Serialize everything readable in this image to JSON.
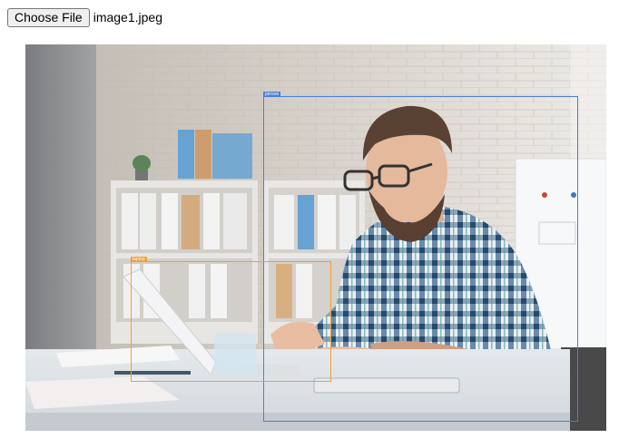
{
  "file_input": {
    "button_label": "Choose File",
    "file_name": "image1.jpeg"
  },
  "detections": [
    {
      "label": "person",
      "color": "#4a7fd6"
    },
    {
      "label": "laptop",
      "color": "#f0a030"
    }
  ]
}
